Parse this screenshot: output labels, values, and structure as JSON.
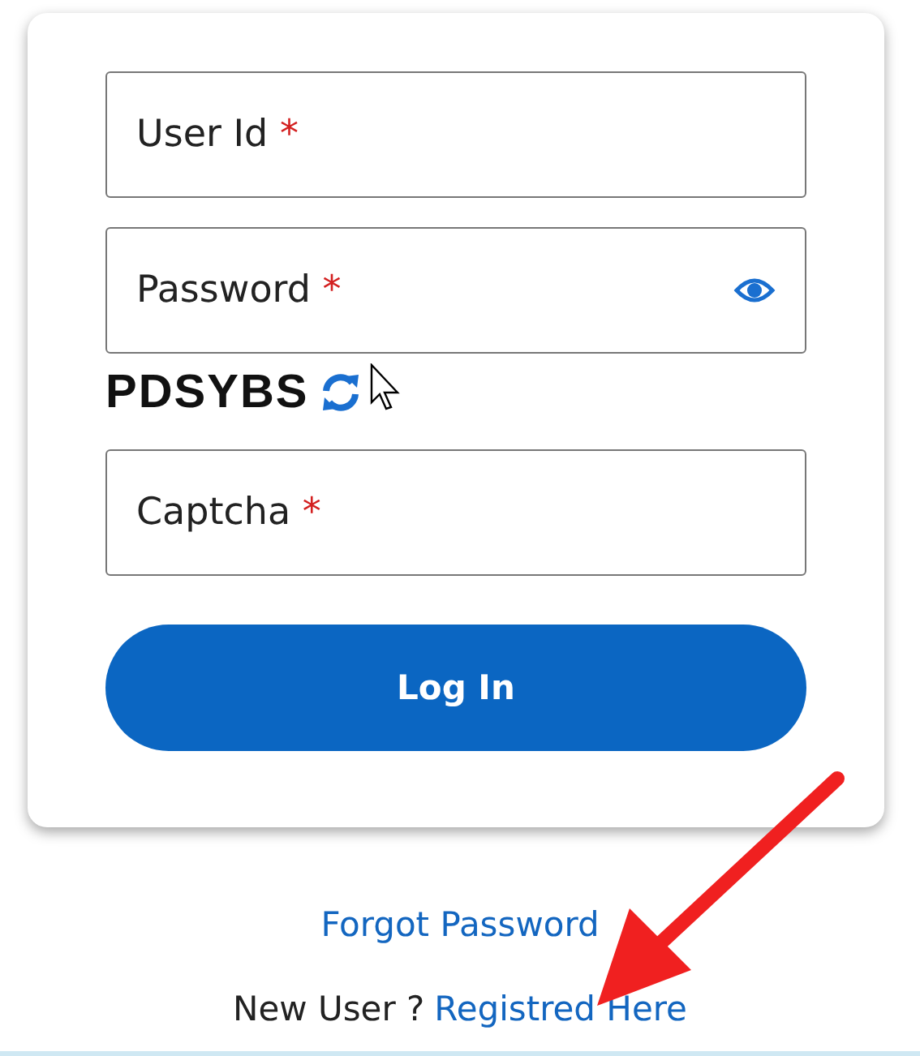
{
  "login_form": {
    "fields": [
      {
        "kind": "text",
        "label": "User Id",
        "required_mark": "*"
      },
      {
        "kind": "password",
        "label": "Password",
        "required_mark": "*"
      },
      {
        "kind": "captcha",
        "label": "Captcha",
        "required_mark": "*",
        "captcha_text": "PDSYBS"
      }
    ],
    "submit": "Log In"
  },
  "links": {
    "forgot": "Forgot Password",
    "new_user_prompt": "New User ?",
    "register": "Registred Here"
  }
}
